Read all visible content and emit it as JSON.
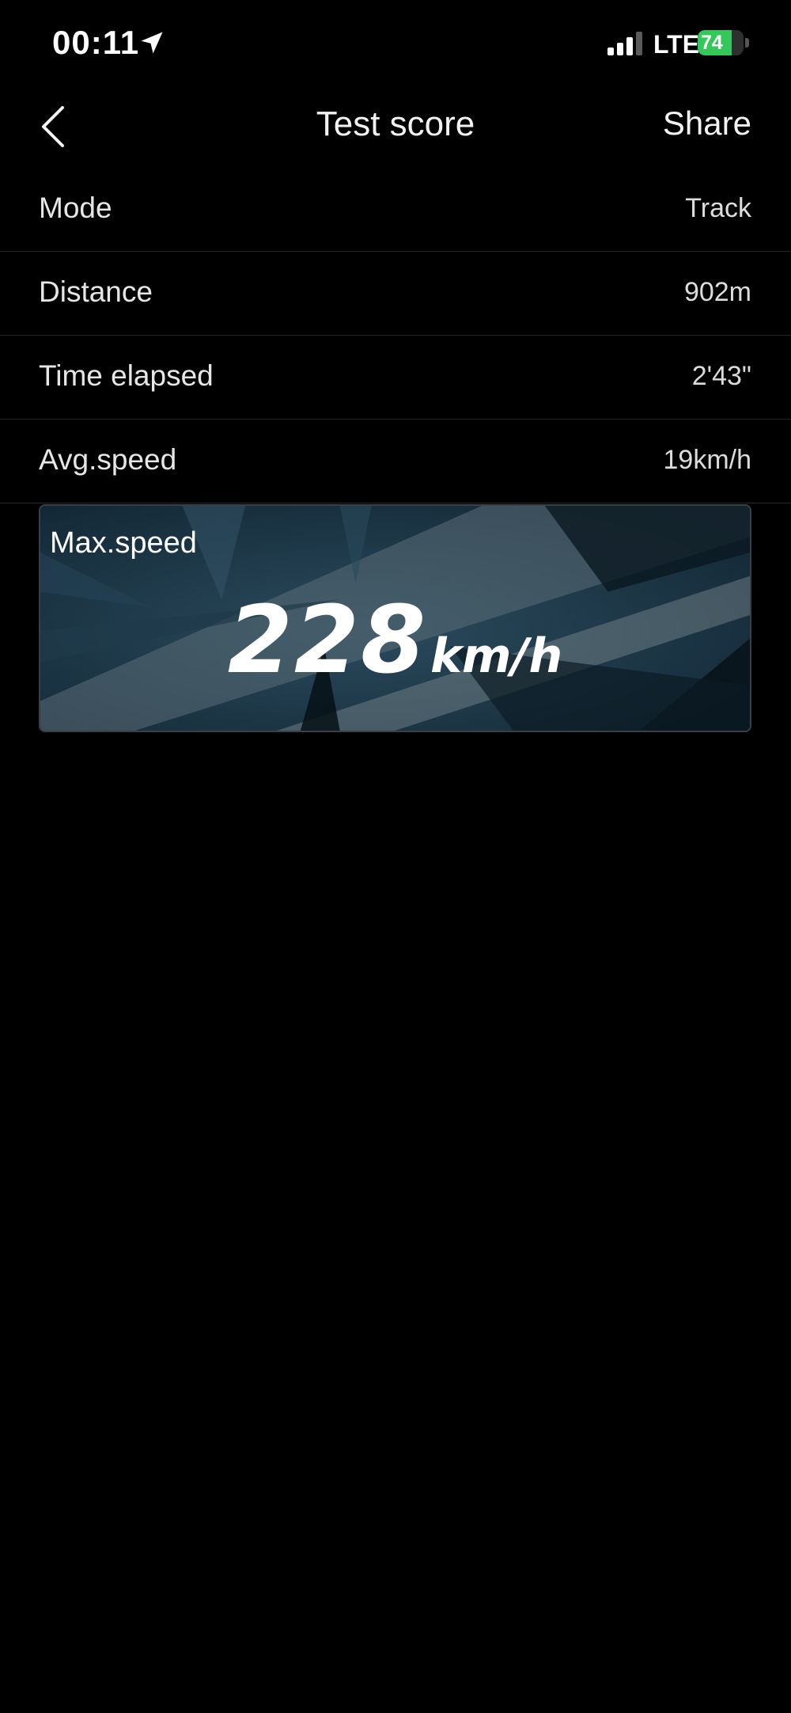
{
  "status_bar": {
    "time": "00:11",
    "network": "LTE",
    "battery_percent": "74",
    "battery_level": 0.74,
    "battery_color": "#34c759"
  },
  "nav": {
    "back_icon": "chevron-left-icon",
    "title": "Test score",
    "share_label": "Share"
  },
  "rows": [
    {
      "label": "Mode",
      "value": "Track"
    },
    {
      "label": "Distance",
      "value": "902m"
    },
    {
      "label": "Time elapsed",
      "value": "2'43\""
    },
    {
      "label": "Avg.speed",
      "value": "19km/h"
    }
  ],
  "max_speed": {
    "label": "Max.speed",
    "value": "228",
    "unit": "km/h"
  }
}
